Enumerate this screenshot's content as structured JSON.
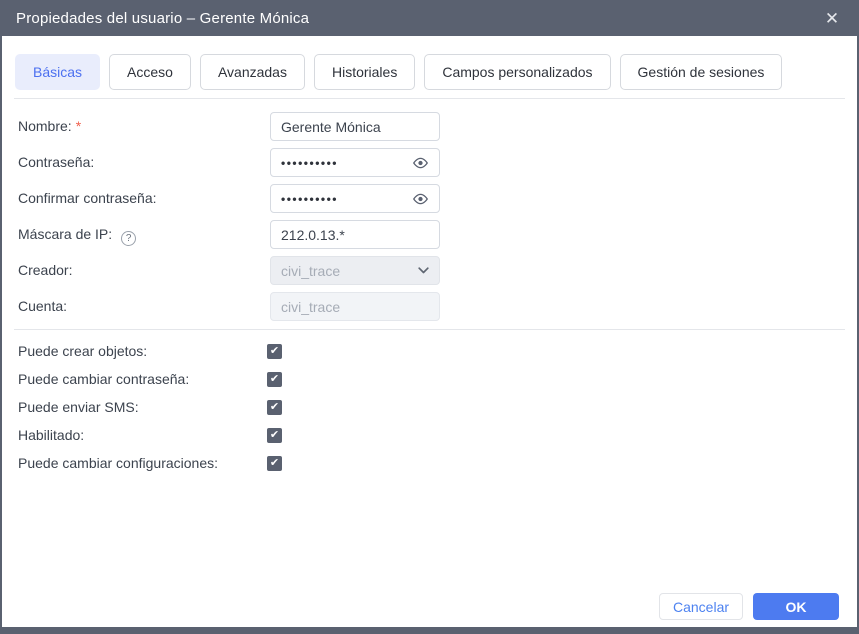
{
  "dialog": {
    "title": "Propiedades del usuario – Gerente Mónica",
    "close_glyph": "✕"
  },
  "tabs": [
    {
      "label": "Básicas",
      "active": true
    },
    {
      "label": "Acceso",
      "active": false
    },
    {
      "label": "Avanzadas",
      "active": false
    },
    {
      "label": "Historiales",
      "active": false
    },
    {
      "label": "Campos personalizados",
      "active": false
    },
    {
      "label": "Gestión de sesiones",
      "active": false
    }
  ],
  "form": {
    "nombre": {
      "label": "Nombre:",
      "required_mark": "*",
      "value": "Gerente Mónica"
    },
    "contrasena": {
      "label": "Contraseña:",
      "masked_value": "••••••••••"
    },
    "confirmar": {
      "label": "Confirmar contraseña:",
      "masked_value": "••••••••••"
    },
    "mascara": {
      "label": "Máscara de IP:",
      "help_glyph": "?",
      "value": "212.0.13.*"
    },
    "creador": {
      "label": "Creador:",
      "value": "civi_trace",
      "disabled": true
    },
    "cuenta": {
      "label": "Cuenta:",
      "value": "civi_trace",
      "disabled": true
    }
  },
  "checkboxes": [
    {
      "label": "Puede crear objetos:",
      "checked": true
    },
    {
      "label": "Puede cambiar contraseña:",
      "checked": true
    },
    {
      "label": "Puede enviar SMS:",
      "checked": true
    },
    {
      "label": "Habilitado:",
      "checked": true
    },
    {
      "label": "Puede cambiar configuraciones:",
      "checked": true
    }
  ],
  "check_glyph": "✔",
  "footer": {
    "cancel_label": "Cancelar",
    "ok_label": "OK"
  },
  "colors": {
    "frame": "#5a6170",
    "accent_blue": "#4d7bf0",
    "active_tab_bg": "#e9edfc",
    "required_red": "#f0604d"
  }
}
